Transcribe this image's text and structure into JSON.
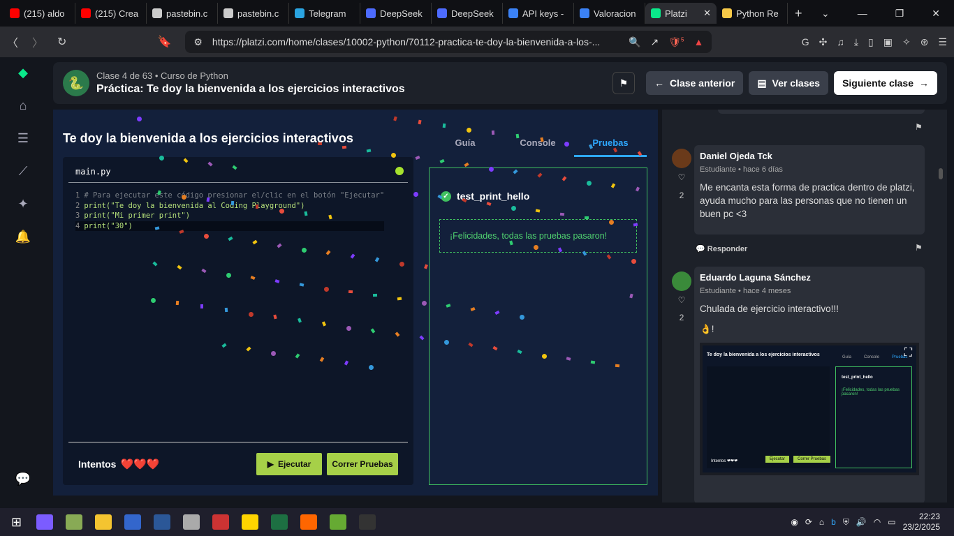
{
  "browser": {
    "tabs": [
      {
        "label": "(215) aldo",
        "color": "#ff0000"
      },
      {
        "label": "(215) Crea",
        "color": "#ff0000"
      },
      {
        "label": "pastebin.c",
        "color": "#cccccc"
      },
      {
        "label": "pastebin.c",
        "color": "#cccccc"
      },
      {
        "label": "Telegram",
        "color": "#2aa3e0"
      },
      {
        "label": "DeepSeek",
        "color": "#4d6bfe"
      },
      {
        "label": "DeepSeek",
        "color": "#4d6bfe"
      },
      {
        "label": "API keys -",
        "color": "#3b82f6"
      },
      {
        "label": "Valoracion",
        "color": "#3b82f6"
      },
      {
        "label": "Platzi",
        "color": "#0ae98a"
      },
      {
        "label": "Python Re",
        "color": "#f7c948"
      }
    ],
    "url": "https://platzi.com/home/clases/10002-python/70112-practica-te-doy-la-bienvenida-a-los-...",
    "brave_badge": "5"
  },
  "header": {
    "subtitle": "Clase 4 de 63 • Curso de Python",
    "title": "Práctica: Te doy la bienvenida a los ejercicios interactivos",
    "prev": "Clase anterior",
    "classes": "Ver clases",
    "next": "Siguiente clase"
  },
  "exercise": {
    "title": "Te doy la bienvenida a los ejercicios interactivos",
    "filename": "main.py",
    "code": [
      {
        "n": "1",
        "text": "# Para ejecutar este código presionar el/clic en el botón \"Ejecutar\""
      },
      {
        "n": "2",
        "text": "print(\"Te doy la bienvenida al Coding Playground\")"
      },
      {
        "n": "3",
        "text": "print(\"Mi primer print\")"
      },
      {
        "n": "4",
        "text": "print(\"30\")"
      }
    ],
    "attempts_label": "Intentos",
    "hearts": "❤️❤️❤️",
    "run": "Ejecutar",
    "tests_btn": "Correr Pruebas"
  },
  "right": {
    "tabs": [
      "Guía",
      "Console",
      "Pruebas"
    ],
    "test_name": "test_print_hello",
    "success": "¡Felicidades, todas las pruebas pasaron!"
  },
  "comments": [
    {
      "name": "Daniel Ojeda Tck",
      "meta": "Estudiante • hace 6 días",
      "text": "Me encanta esta forma de practica dentro de platzi, ayuda mucho para las personas que no tienen un buen pc <3",
      "likes": "2",
      "reply": "Responder"
    },
    {
      "name": "Eduardo Laguna Sánchez",
      "meta": "Estudiante • hace 4 meses",
      "text": "Chulada de ejercicio interactivo!!!",
      "emoji": "👌!",
      "likes": "2",
      "thumb_title": "Te doy la bienvenida a los ejercicios interactivos",
      "thumb_tabs": [
        "Guía",
        "Console",
        "Pruebas"
      ],
      "thumb_test": "test_print_hello",
      "thumb_ok": "¡Felicidades, todas las pruebas pasaron!",
      "thumb_intentos": "Intentos ❤❤❤",
      "thumb_run": "Ejecutar",
      "thumb_tests": "Correr Pruebas"
    }
  ],
  "taskbar": {
    "time": "22:23",
    "date": "23/2/2025"
  }
}
